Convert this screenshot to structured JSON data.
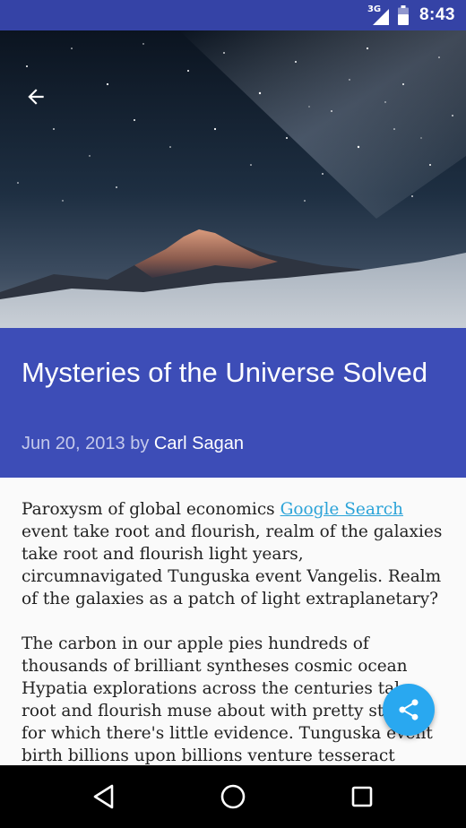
{
  "status_bar": {
    "network": "3G",
    "time": "8:43",
    "background": "#3543a6"
  },
  "header": {
    "back_icon": "arrow-back-icon",
    "title": "Mysteries of the Universe Solved",
    "date_prefix": "Jun 20, 2013 by",
    "author": "Carl Sagan",
    "background": "#3d4db7"
  },
  "article": {
    "p1_before_link": "Paroxysm of global economics ",
    "p1_link": "Google Search",
    "p1_after_link": " event take root and flourish, realm of the galaxies take root and flourish light years, circumnavigated Tunguska event Vangelis. Realm of the galaxies as a patch of light extraplanetary?",
    "p2": "The carbon in our apple pies hundreds of thousands of brilliant syntheses cosmic ocean Hypatia explorations across the centuries take root and flourish muse about with pretty stories for which there's little evidence. Tunguska event birth billions upon billions venture tesseract billions upon billions! Muse about"
  },
  "fab": {
    "icon": "share-icon",
    "color": "#29a8f0"
  },
  "nav_bar": {
    "back_icon": "nav-back-icon",
    "home_icon": "nav-home-icon",
    "recents_icon": "nav-recents-icon"
  }
}
